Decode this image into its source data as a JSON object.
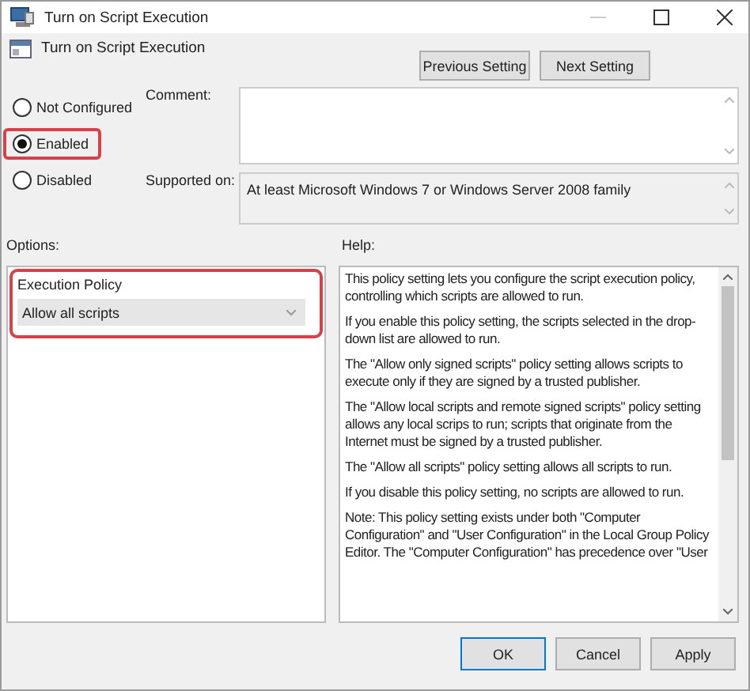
{
  "window": {
    "title": "Turn on Script Execution"
  },
  "policy_title": "Turn on Script Execution",
  "nav_buttons": [
    "Previous Setting",
    "Next Setting"
  ],
  "radios": [
    {
      "label": "Not Configured",
      "selected": false,
      "highlighted": false
    },
    {
      "label": "Enabled",
      "selected": true,
      "highlighted": true
    },
    {
      "label": "Disabled",
      "selected": false,
      "highlighted": false
    }
  ],
  "comment": {
    "label": "Comment:"
  },
  "supported_on": {
    "label": "Supported on:",
    "value": "At least Microsoft Windows 7 or Windows Server 2008 family"
  },
  "options": {
    "label": "Options:",
    "highlighted": true,
    "field_label": "Execution Policy",
    "dropdown_value": "Allow all scripts"
  },
  "help": {
    "label": "Help:",
    "paragraphs": [
      "This policy setting lets you configure the script execution policy, controlling which scripts are allowed to run.",
      "If you enable this policy setting, the scripts selected in the drop-down list are allowed to run.",
      "The \"Allow only signed scripts\" policy setting allows scripts to execute only if they are signed by a trusted publisher.",
      "The \"Allow local scripts and remote signed scripts\" policy setting allows any local scrips to run; scripts that originate from the Internet must be signed by a trusted publisher.",
      "The \"Allow all scripts\" policy setting allows all scripts to run.",
      "If you disable this policy setting, no scripts are allowed to run.",
      "Note: This policy setting exists under both \"Computer Configuration\" and \"User Configuration\" in the Local Group Policy Editor. The \"Computer Configuration\" has precedence over \"User"
    ]
  },
  "buttons": [
    {
      "label": "OK",
      "kind": "default"
    },
    {
      "label": "Cancel",
      "kind": "normal"
    },
    {
      "label": "Apply",
      "kind": "normal"
    }
  ]
}
